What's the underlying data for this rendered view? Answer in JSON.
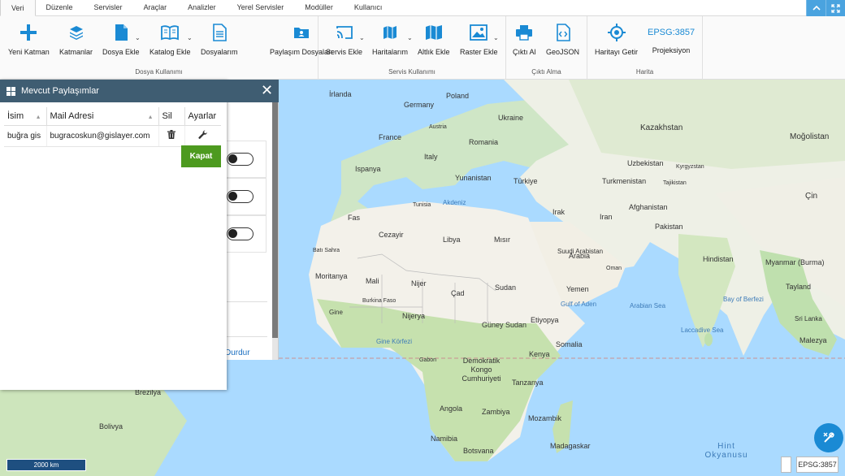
{
  "tabs": [
    "Veri",
    "Düzenle",
    "Servisler",
    "Araçlar",
    "Analizler",
    "Yerel Servisler",
    "Modüller",
    "Kullanıcı"
  ],
  "active_tab": "Veri",
  "window_buttons": {
    "restore": "^",
    "maximize": "⤢"
  },
  "ribbon": {
    "dosya": {
      "label": "Dosya Kullanımı",
      "buttons": [
        "Yeni Katman",
        "Katmanlar",
        "Dosya Ekle",
        "Katalog Ekle",
        "Dosyalarım",
        "Paylaşım Dosyaları"
      ]
    },
    "servis": {
      "label": "Servis Kullanımı",
      "buttons": [
        "Servis Ekle",
        "Haritalarım",
        "Altlık Ekle",
        "Raster Ekle"
      ]
    },
    "cikti": {
      "label": "Çıktı Alma",
      "buttons": [
        "Çıktı Al",
        "GeoJSON"
      ]
    },
    "harita": {
      "label": "Harita",
      "buttons": [
        "Haritayı Getir",
        "Projeksiyon"
      ],
      "epsg": "EPSG:3857"
    }
  },
  "colors": {
    "accent": "#1a8ad4",
    "header": "#3f5d72",
    "kapat": "#4d9a1f"
  },
  "dialog": {
    "title": "Mevcut Paylaşımlar",
    "columns": [
      "İsim",
      "Mail Adresi",
      "Sil",
      "Ayarlar"
    ],
    "rows": [
      {
        "name": "buğra gis",
        "email": "bugracoskun@gislayer.com"
      }
    ],
    "close_button": "Kapat"
  },
  "under_panel": {
    "link": "Durdur"
  },
  "map_labels": {
    "countries": [
      "İrlanda",
      "Germany",
      "Poland",
      "France",
      "Ukraine",
      "Austria",
      "Romania",
      "Kazakhstan",
      "Moğolistan",
      "Italy",
      "Ispanya",
      "Yunanistan",
      "Türkiye",
      "Uzbekistan",
      "Kyrgyzstan",
      "Turkmenistan",
      "Tajikistan",
      "Tunisia",
      "Irak",
      "Iran",
      "Afghanistan",
      "Çin",
      "Pakistan",
      "Fas",
      "Cezayir",
      "Libya",
      "Mısır",
      "Suudi Arabistan",
      "Arabia",
      "Hindistan",
      "Oman",
      "Myanmar (Burma)",
      "Batı Sahra",
      "Moritanya",
      "Mali",
      "Nijer",
      "Çad",
      "Sudan",
      "Yemen",
      "Tayland",
      "Burkina Faso",
      "Gine",
      "Nijerya",
      "Güney Sudan",
      "Etiyopya",
      "Sri Lanka",
      "Malezya",
      "Gabon",
      "Kenya",
      "Somalia",
      "Demokratik Kongo Cumhuriyeti",
      "Tanzanya",
      "Brezilya",
      "Angola",
      "Zambiya",
      "Mozambik",
      "Bolivya",
      "Namibia",
      "Botsvana",
      "Madagaskar"
    ],
    "seas": [
      "Akdeniz",
      "Gulf of Aden",
      "Arabian Sea",
      "Bay of Berfezi",
      "Laccadive Sea",
      "Gine Körfezi",
      "Hint Okyanusu"
    ]
  },
  "scale": "2000 km",
  "projection_badge": "EPSG:3857"
}
